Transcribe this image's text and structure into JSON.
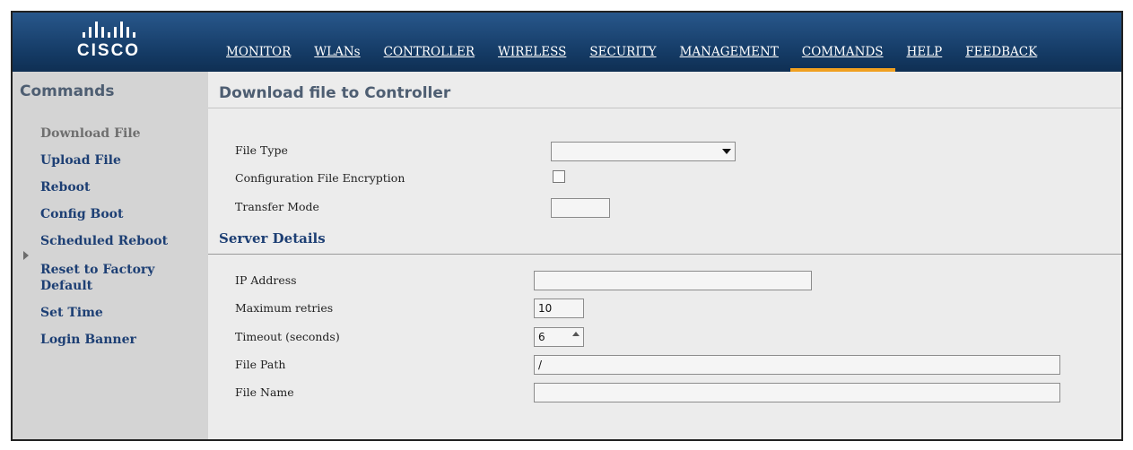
{
  "brand": {
    "logo_text": "CISCO",
    "logo_icon": "cisco-bridge-logo"
  },
  "nav": {
    "items": [
      {
        "label": "MONITOR"
      },
      {
        "label": "WLANs"
      },
      {
        "label": "CONTROLLER"
      },
      {
        "label": "WIRELESS"
      },
      {
        "label": "SECURITY"
      },
      {
        "label": "MANAGEMENT"
      },
      {
        "label": "COMMANDS",
        "active": true
      },
      {
        "label": "HELP"
      },
      {
        "label": "FEEDBACK"
      }
    ]
  },
  "sidebar": {
    "title": "Commands",
    "items": [
      {
        "label": "Download File",
        "current": true
      },
      {
        "label": "Upload File"
      },
      {
        "label": "Reboot"
      },
      {
        "label": "Config Boot"
      },
      {
        "label": "Scheduled Reboot",
        "expandable": true
      },
      {
        "label": "Reset to Factory Default"
      },
      {
        "label": "Set Time"
      },
      {
        "label": "Login Banner"
      }
    ]
  },
  "main": {
    "title": "Download file to Controller",
    "file_type": {
      "label": "File Type",
      "value": ""
    },
    "config_encryption": {
      "label": "Configuration File Encryption",
      "checked": false
    },
    "transfer_mode": {
      "label": "Transfer Mode",
      "value": ""
    },
    "server_details": {
      "title": "Server Details",
      "ip_address": {
        "label": "IP Address",
        "value": ""
      },
      "max_retries": {
        "label": "Maximum retries",
        "value": "10"
      },
      "timeout": {
        "label": "Timeout (seconds)",
        "value": "6"
      },
      "file_path": {
        "label": "File Path",
        "value": "/"
      },
      "file_name": {
        "label": "File Name",
        "value": ""
      }
    }
  },
  "colors": {
    "header_bg": "#1b4675",
    "active_tab_underline": "#f0a020",
    "sidebar_bg": "#d4d4d4",
    "link_color": "#1d3f74"
  }
}
